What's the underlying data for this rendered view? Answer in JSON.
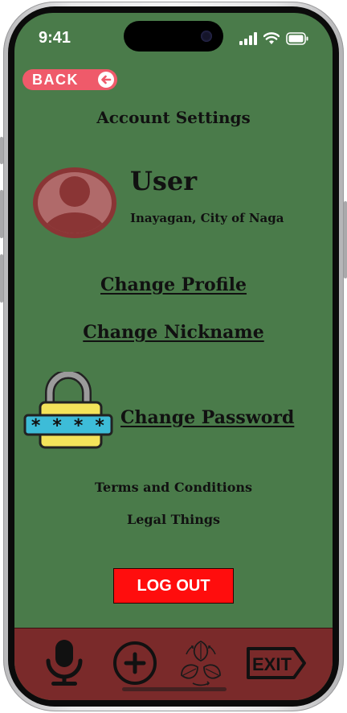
{
  "status_bar": {
    "time": "9:41",
    "icons": [
      "cellular-signal-icon",
      "wifi-icon",
      "battery-icon"
    ]
  },
  "back_button": {
    "label": "BACK"
  },
  "page_title": "Account Settings",
  "user": {
    "name": "User",
    "location": "Inayagan, City of Naga"
  },
  "settings": {
    "change_profile": "Change Profile",
    "change_nickname": "Change Nickname",
    "change_password": "Change Password",
    "terms": "Terms and Conditions",
    "legal": "Legal Things"
  },
  "password_mask": "* * * * _",
  "logout_label": "LOG OUT",
  "bottom_nav": {
    "items": [
      "microphone-icon",
      "add-icon",
      "recycle-leaves-icon",
      "exit-sign-icon"
    ],
    "exit_label": "EXIT"
  },
  "colors": {
    "background": "#4a7b4a",
    "bottom_bar": "#7a2a2a",
    "logout_button": "#ff0d0d",
    "back_button": "#ef5a6a",
    "avatar": "#8a3535"
  }
}
